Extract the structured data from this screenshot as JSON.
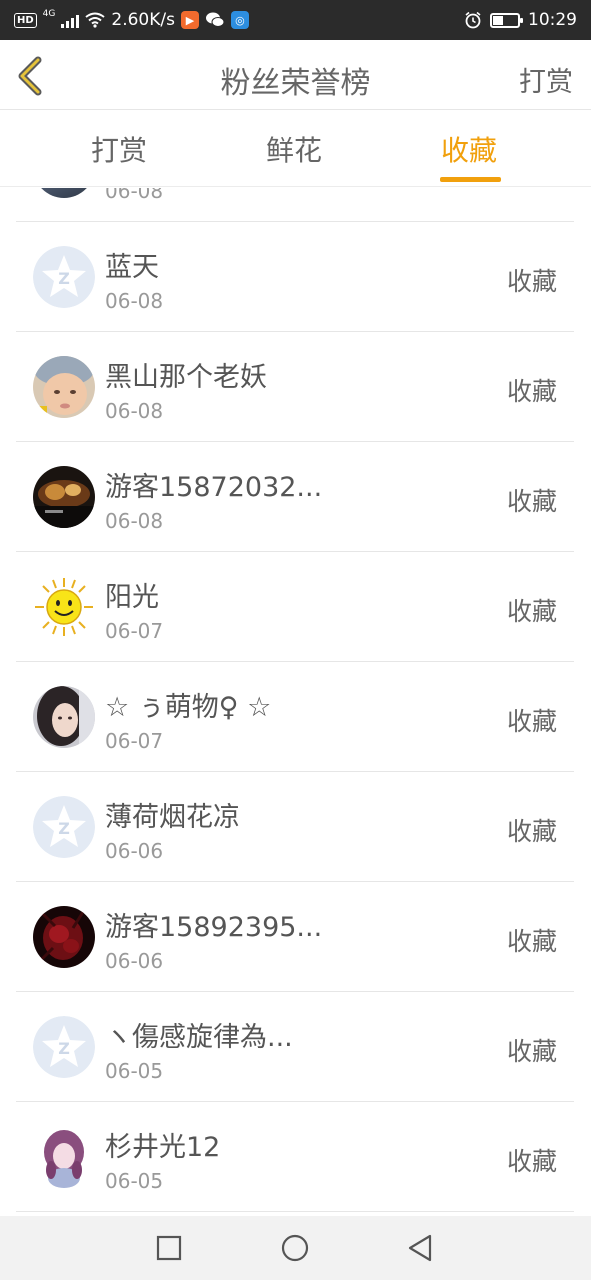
{
  "status_bar": {
    "hd": "HD",
    "net": "4G",
    "speed": "2.60K/s",
    "time": "10:29",
    "battery_level": 0.45,
    "icons": [
      "hd-icon",
      "signal-icon",
      "wifi-icon",
      "video-app-icon",
      "wechat-icon",
      "browser-app-icon",
      "alarm-icon",
      "battery-icon"
    ]
  },
  "header": {
    "title": "粉丝荣誉榜",
    "action": "打赏"
  },
  "tabs": [
    {
      "label": "打赏",
      "active": false
    },
    {
      "label": "鲜花",
      "active": false
    },
    {
      "label": "收藏",
      "active": true
    }
  ],
  "colors": {
    "accent": "#f1a00d",
    "text": "#666666",
    "secondary": "#999999",
    "divider": "#e6e6e6"
  },
  "list": [
    {
      "name": "",
      "date": "06-08",
      "action": "",
      "avatar": "photo-avatar"
    },
    {
      "name": "蓝天",
      "date": "06-08",
      "action": "收藏",
      "avatar": "default-qq-avatar"
    },
    {
      "name": "黑山那个老妖",
      "date": "06-08",
      "action": "收藏",
      "avatar": "baby-photo-avatar"
    },
    {
      "name": "游客15872032...",
      "date": "06-08",
      "action": "收藏",
      "avatar": "game-art-avatar"
    },
    {
      "name": "阳光",
      "date": "06-07",
      "action": "收藏",
      "avatar": "sun-smiley-avatar"
    },
    {
      "name": "☆ ぅ萌物♀ ☆",
      "date": "06-07",
      "action": "收藏",
      "avatar": "girl-photo-avatar"
    },
    {
      "name": "薄荷烟花凉",
      "date": "06-06",
      "action": "收藏",
      "avatar": "default-qq-avatar"
    },
    {
      "name": "游客15892395...",
      "date": "06-06",
      "action": "收藏",
      "avatar": "dark-red-art-avatar"
    },
    {
      "name": "ヽ傷感旋律為...",
      "date": "06-05",
      "action": "收藏",
      "avatar": "default-qq-avatar"
    },
    {
      "name": "杉井光12",
      "date": "06-05",
      "action": "收藏",
      "avatar": "anime-girl-avatar"
    }
  ],
  "nav": [
    "square-recents-icon",
    "circle-home-icon",
    "triangle-back-icon"
  ]
}
